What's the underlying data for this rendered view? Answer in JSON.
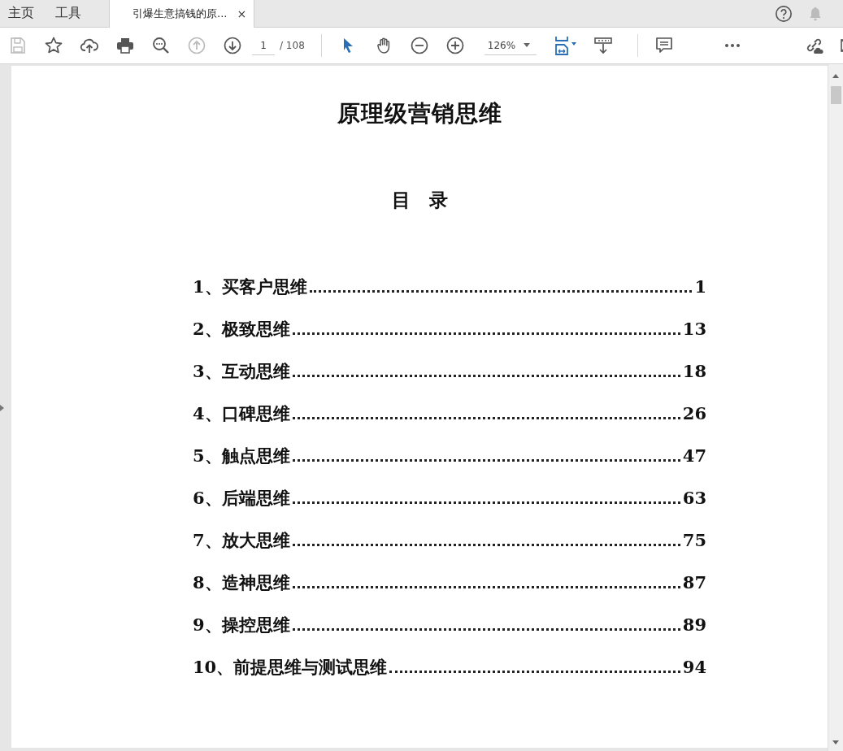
{
  "tabs": [
    {
      "label": "主页",
      "selected": false
    },
    {
      "label": "工具",
      "selected": false
    },
    {
      "label": "引爆生意搞钱的原...",
      "selected": true,
      "close": "×"
    }
  ],
  "toolbar": {
    "file_buttons": [
      {
        "disabled": true
      },
      {
        "disabled": false
      },
      {
        "disabled": false
      },
      {
        "disabled": false
      },
      {
        "disabled": false
      },
      {
        "disabled": true
      },
      {
        "disabled": false
      }
    ],
    "page_field": {
      "value": "1",
      "total": "/ 108"
    },
    "tools": [
      {
        "selected": true
      },
      {
        "selected": false
      }
    ],
    "zoom_field": {
      "value": "126%"
    }
  },
  "document": {
    "title": "原理级营销思维",
    "heading": "目　录",
    "entries": [
      {
        "label": "1、买客户思维",
        "page": "1"
      },
      {
        "label": "2、极致思维",
        "page": "13"
      },
      {
        "label": "3、互动思维",
        "page": "18"
      },
      {
        "label": "4、口碑思维",
        "page": "26"
      },
      {
        "label": "5、触点思维",
        "page": "47"
      },
      {
        "label": "6、后端思维",
        "page": "63"
      },
      {
        "label": "7、放大思维",
        "page": "75"
      },
      {
        "label": "8、造神思维",
        "page": "87"
      },
      {
        "label": "9、操控思维",
        "page": "89"
      },
      {
        "label": "10、前提思维与测试思维",
        "page": "94"
      }
    ]
  }
}
